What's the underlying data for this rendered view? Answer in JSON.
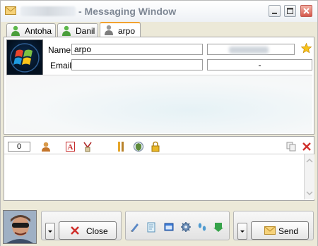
{
  "window": {
    "title": "- Messaging Window",
    "title_prefix_redacted": true,
    "controls": [
      "minimize-icon",
      "maximize-icon",
      "close-icon"
    ]
  },
  "tabs": [
    {
      "label": "Antoha",
      "icon": "user-green-icon",
      "active": false
    },
    {
      "label": "Danil",
      "icon": "user-green-icon",
      "active": false
    },
    {
      "label": "arpo",
      "icon": "user-gray-icon",
      "active": true
    }
  ],
  "contact": {
    "name_label": "Name:",
    "name_value": "arpo",
    "email_label": "Email:",
    "email_value": "",
    "info_value": "-",
    "status_redacted": true
  },
  "compose": {
    "char_count": "0",
    "tools": [
      "user-icon",
      "font-icon",
      "clear-format-icon",
      "bars-icon",
      "shield-icon",
      "lock-icon"
    ],
    "right_tools": [
      "copy-icon",
      "delete-icon"
    ]
  },
  "buttons": {
    "close_label": "Close",
    "send_label": "Send"
  },
  "action_icons": [
    "edit-icon",
    "notepad-icon",
    "window-icon",
    "gear-icon",
    "footsteps-icon",
    "download-icon"
  ],
  "colors": {
    "active_tab_accent": "#f2a22f",
    "title_text": "#7e8794",
    "close_button": "#d5584b"
  }
}
